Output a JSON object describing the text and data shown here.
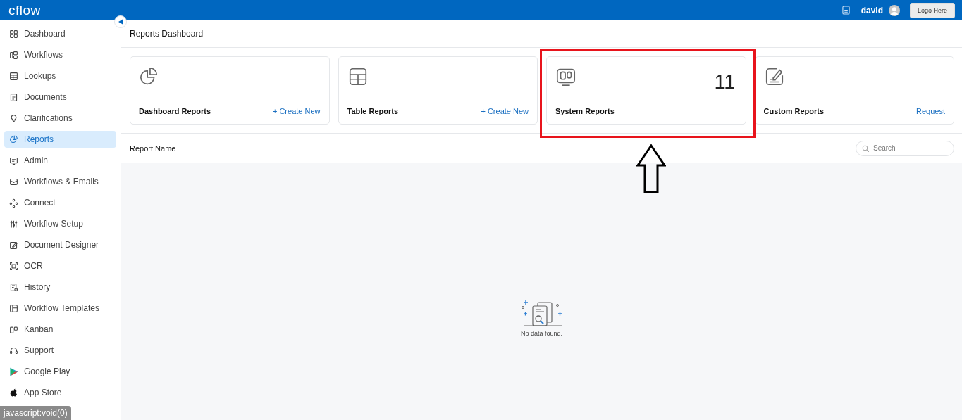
{
  "topbar": {
    "logo": "cflow",
    "user": "david",
    "logo_button": "Logo Here"
  },
  "sidebar": {
    "items": [
      {
        "label": "Dashboard",
        "selected": false
      },
      {
        "label": "Workflows",
        "selected": false
      },
      {
        "label": "Lookups",
        "selected": false
      },
      {
        "label": "Documents",
        "selected": false
      },
      {
        "label": "Clarifications",
        "selected": false
      },
      {
        "label": "Reports",
        "selected": true
      },
      {
        "label": "Admin",
        "selected": false
      },
      {
        "label": "Workflows & Emails",
        "selected": false
      },
      {
        "label": "Connect",
        "selected": false
      },
      {
        "label": "Workflow Setup",
        "selected": false
      },
      {
        "label": "Document Designer",
        "selected": false
      },
      {
        "label": "OCR",
        "selected": false
      },
      {
        "label": "History",
        "selected": false
      },
      {
        "label": "Workflow Templates",
        "selected": false
      },
      {
        "label": "Kanban",
        "selected": false
      },
      {
        "label": "Support",
        "selected": false
      },
      {
        "label": "Google Play",
        "selected": false
      },
      {
        "label": "App Store",
        "selected": false
      }
    ]
  },
  "page_title": "Reports Dashboard",
  "cards": [
    {
      "title": "Dashboard Reports",
      "kind": "link",
      "action": "+ Create New"
    },
    {
      "title": "Table Reports",
      "kind": "link",
      "action": "+ Create New"
    },
    {
      "title": "System Reports",
      "kind": "count",
      "count": "11"
    },
    {
      "title": "Custom Reports",
      "kind": "link",
      "action": "Request"
    }
  ],
  "table": {
    "column_1": "Report Name",
    "search": {
      "placeholder": "Search"
    },
    "empty_message": "No data found."
  },
  "status_bar": "javascript:void(0)"
}
